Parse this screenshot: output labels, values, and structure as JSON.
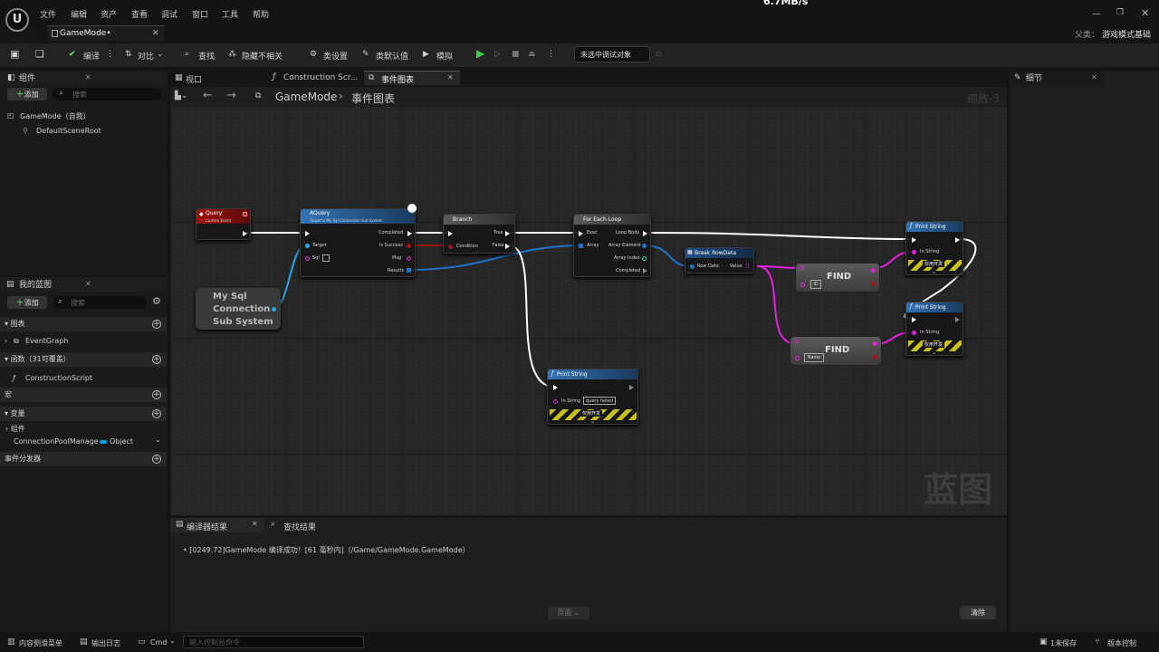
{
  "status": {
    "speed": "6.7MB/s"
  },
  "menu": [
    "文件",
    "编辑",
    "资产",
    "查看",
    "调试",
    "窗口",
    "工具",
    "帮助"
  ],
  "doc_tab": "GameMode•",
  "parent": {
    "label": "父类：",
    "value": "游戏模式基础"
  },
  "toolbar": {
    "compile": "编译",
    "diff": "对比",
    "find": "查找",
    "hide": "隐藏不相关",
    "class_settings": "类设置",
    "class_defaults": "类默认值",
    "simulate": "模拟",
    "debug_target": "未选中调试对象"
  },
  "components": {
    "title": "组件",
    "add": "添加",
    "search_placeholder": "搜索",
    "root": "GameMode（自我）",
    "child": "DefaultSceneRoot"
  },
  "mybp": {
    "title": "我的蓝图",
    "add": "添加",
    "search_placeholder": "搜索",
    "graphs": "图表",
    "event_graph": "EventGraph",
    "functions": "函数（31可覆盖）",
    "construction": "ConstructionScript",
    "macros": "宏",
    "variables": "变量",
    "var_group": "组件",
    "var_name": "ConnectionPoolManage",
    "var_type": "Object",
    "dispatchers": "事件分发器"
  },
  "editor_tabs": {
    "viewport": "视口",
    "construction": "Construction Scr...",
    "event_graph": "事件图表"
  },
  "breadcrumb": {
    "root": "GameMode",
    "current": "事件图表",
    "zoom": "缩放-3"
  },
  "watermark": "蓝图",
  "details": {
    "title": "细节"
  },
  "nodes": {
    "query": {
      "title": "Query",
      "sub": "Custom Event"
    },
    "aquery": {
      "title": "AQuery",
      "sub": "Target is My Sql Connection Sub System",
      "target": "Target",
      "sql": "Sql",
      "completed": "Completed",
      "is_success": "Is Success",
      "msg": "Msg",
      "results": "Results"
    },
    "mysql": {
      "l1": "My Sql",
      "l2": "Connection",
      "l3": "Sub System"
    },
    "branch": {
      "title": "Branch",
      "condition": "Condition",
      "true": "True",
      "false": "False"
    },
    "foreach": {
      "title": "For Each Loop",
      "exec": "Exec",
      "array": "Array",
      "loop_body": "Loop Body",
      "array_element": "Array Element",
      "array_index": "Array Index",
      "completed": "Completed"
    },
    "break": {
      "title": "Break RowData",
      "row": "Row Data",
      "value": "Value"
    },
    "find1": {
      "title": "FIND",
      "key": "ID"
    },
    "find2": {
      "title": "FIND",
      "key": "Name"
    },
    "print_fail": {
      "title": "Print String",
      "in": "In String",
      "value": "query failed",
      "dev": "仅用开发"
    },
    "print1": {
      "title": "Print String",
      "in": "In String",
      "dev": "仅用开发"
    },
    "print2": {
      "title": "Print String",
      "in": "In String",
      "dev": "仅用开发"
    }
  },
  "output": {
    "tab1": "编译器结果",
    "tab2": "查找结果",
    "log": "[0249.72]GameMode 编译成功！[61 毫秒内]（/Game/GameMode.GameMode）",
    "page": "页面",
    "clear": "清除"
  },
  "statusbar": {
    "drawer": "内容侧滑菜单",
    "log": "输出日志",
    "cmd": "Cmd",
    "console_placeholder": "输入控制台命令",
    "unsaved": "1未保存",
    "source": "版本控制"
  }
}
